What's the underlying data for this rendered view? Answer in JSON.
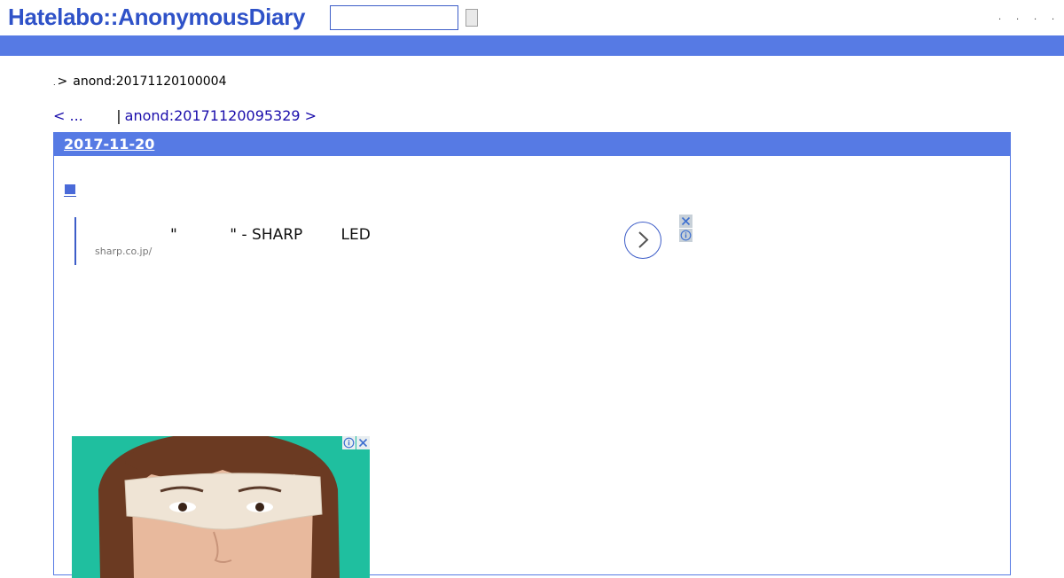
{
  "header": {
    "logo_text": "Hatelabo::AnonymousDiary",
    "search": {
      "value": "",
      "placeholder": ""
    },
    "search_button_label": "",
    "links": [
      ".",
      ".",
      ".",
      "."
    ]
  },
  "breadcrumb": {
    "home": ".",
    "separator": ">",
    "current": "anond:20171120100004"
  },
  "pager": {
    "prev": "< ...      ",
    "separator": "|",
    "next": "anond:20171120095329 >"
  },
  "day": {
    "date": "2017-11-20",
    "section_mark": "■"
  },
  "text_ad": {
    "headline": "\"           \" - SHARP        LED",
    "url": "sharp.co.jp/"
  },
  "colors": {
    "accent": "#567ae4",
    "logo": "#2f52c8",
    "link": "#1a0dab",
    "ad_image_bg": "#1fbf9f"
  },
  "icons": {
    "arrow": "chevron-right-icon",
    "close": "close-icon",
    "info": "info-icon"
  }
}
